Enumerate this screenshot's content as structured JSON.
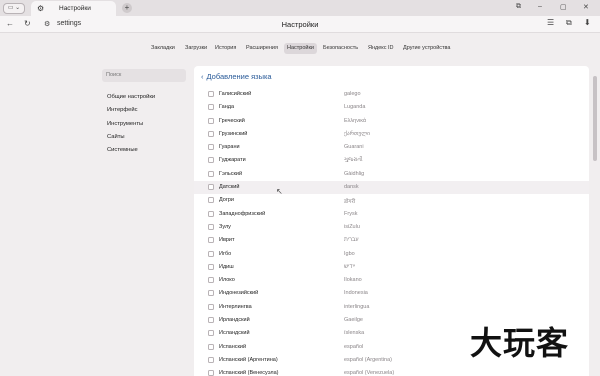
{
  "tab": {
    "title": "Настройки",
    "close": "×",
    "new": "+"
  },
  "tabgroup": {
    "label": "▭ ⌄"
  },
  "window": {
    "controls": [
      "⧉",
      "–",
      "▢",
      "✕"
    ]
  },
  "address": {
    "url": "settings",
    "page_title": "Настройки"
  },
  "toolbar_right": [
    "☰",
    "⧉",
    "⬇"
  ],
  "settings_tabs": [
    {
      "label": "Закладки",
      "active": false
    },
    {
      "label": "Загрузки",
      "active": false
    },
    {
      "label": "История",
      "active": false
    },
    {
      "label": "Расширения",
      "active": false
    },
    {
      "label": "Настройки",
      "active": true
    },
    {
      "label": "Безопасность",
      "active": false
    },
    {
      "label": "Яндекс ID",
      "active": false
    },
    {
      "label": "Другие устройства",
      "active": false
    }
  ],
  "sidebar": {
    "search_placeholder": "Поиск",
    "items": [
      "Общие настройки",
      "Интерфейс",
      "Инструменты",
      "Сайты",
      "Системные"
    ]
  },
  "panel": {
    "back_label": "Добавление языка",
    "languages": [
      {
        "name": "Галисийский",
        "native": "galego"
      },
      {
        "name": "Ганда",
        "native": "Luganda"
      },
      {
        "name": "Греческий",
        "native": "Ελληνικά"
      },
      {
        "name": "Грузинский",
        "native": "ქართული"
      },
      {
        "name": "Гуарани",
        "native": "Guarani"
      },
      {
        "name": "Гуджарати",
        "native": "ગુજરાતી"
      },
      {
        "name": "Гэльский",
        "native": "Gàidhlig"
      },
      {
        "name": "Датский",
        "native": "dansk",
        "hover": true
      },
      {
        "name": "Догри",
        "native": "डोगरी"
      },
      {
        "name": "Западнофризский",
        "native": "Frysk"
      },
      {
        "name": "Зулу",
        "native": "isiZulu"
      },
      {
        "name": "Иврит",
        "native": "עברית"
      },
      {
        "name": "Игбо",
        "native": "Igbo"
      },
      {
        "name": "Идиш",
        "native": "ייִדיש"
      },
      {
        "name": "Илоко",
        "native": "Ilokano"
      },
      {
        "name": "Индонезийский",
        "native": "Indonesia"
      },
      {
        "name": "Интерлингва",
        "native": "interlingua"
      },
      {
        "name": "Ирландский",
        "native": "Gaeilge"
      },
      {
        "name": "Исландский",
        "native": "íslenska"
      },
      {
        "name": "Испанский",
        "native": "español"
      },
      {
        "name": "Испанский (Аргентина)",
        "native": "español (Argentina)"
      },
      {
        "name": "Испанский (Венесуэла)",
        "native": "español (Venezuela)"
      }
    ]
  },
  "watermark": "大玩客"
}
